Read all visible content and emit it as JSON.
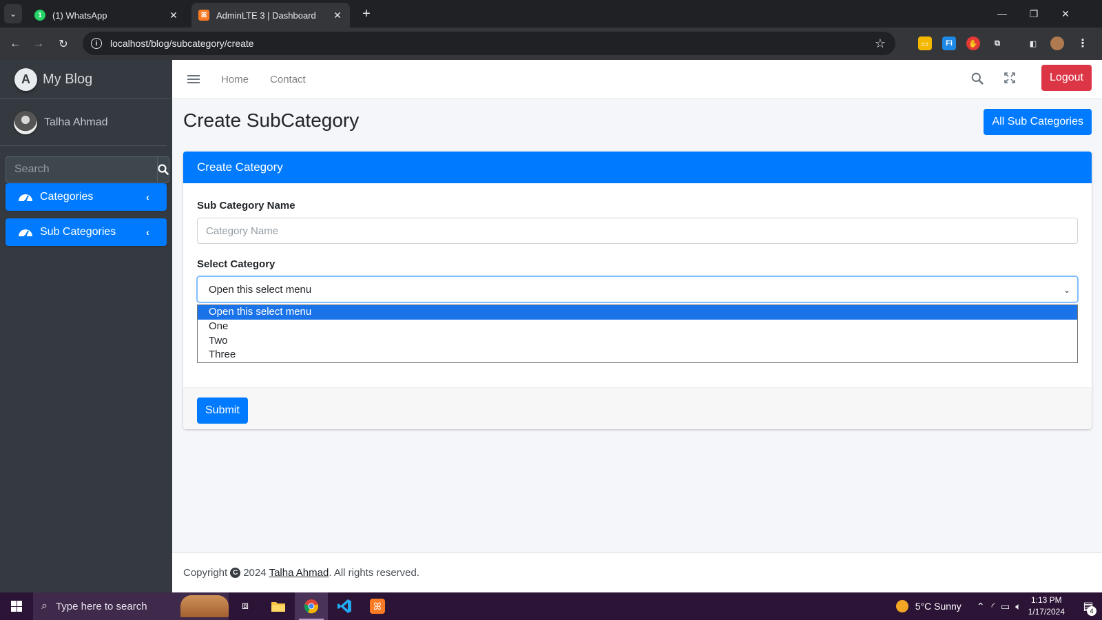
{
  "browser": {
    "tabs": [
      {
        "title": "(1) WhatsApp",
        "favicon": "whatsapp-icon",
        "favicon_text": "1",
        "active": false
      },
      {
        "title": "AdminLTE 3 | Dashboard",
        "favicon": "xampp-icon",
        "active": true
      }
    ],
    "url": "localhost/blog/subcategory/create"
  },
  "sidebar": {
    "brand": "My Blog",
    "brand_logo_letter": "A",
    "user_name": "Talha Ahmad",
    "search_placeholder": "Search",
    "items": [
      {
        "label": "Categories",
        "icon": "dashboard-gauge-icon"
      },
      {
        "label": "Sub Categories",
        "icon": "dashboard-gauge-icon"
      }
    ]
  },
  "topnav": {
    "links": [
      "Home",
      "Contact"
    ],
    "logout_label": "Logout"
  },
  "main": {
    "page_title": "Create SubCategory",
    "all_button": "All Sub Categories",
    "card_title": "Create Category",
    "name_label": "Sub Category Name",
    "name_placeholder": "Category Name",
    "select_label": "Select Category",
    "select_value": "Open this select menu",
    "options": [
      "Open this select menu",
      "One",
      "Two",
      "Three"
    ],
    "selected_index": 0,
    "submit_label": "Submit"
  },
  "footer": {
    "prefix": "Copyright",
    "year": "2024",
    "author": "Talha Ahmad",
    "suffix": ". All rights reserved."
  },
  "taskbar": {
    "search_placeholder": "Type here to search",
    "weather": "5°C  Sunny",
    "time": "1:13 PM",
    "date": "1/17/2024",
    "notification_count": "4"
  },
  "colors": {
    "primary": "#007bff",
    "danger": "#dc3545",
    "sidebar_bg": "#343a40",
    "page_bg": "#f4f6f9"
  }
}
